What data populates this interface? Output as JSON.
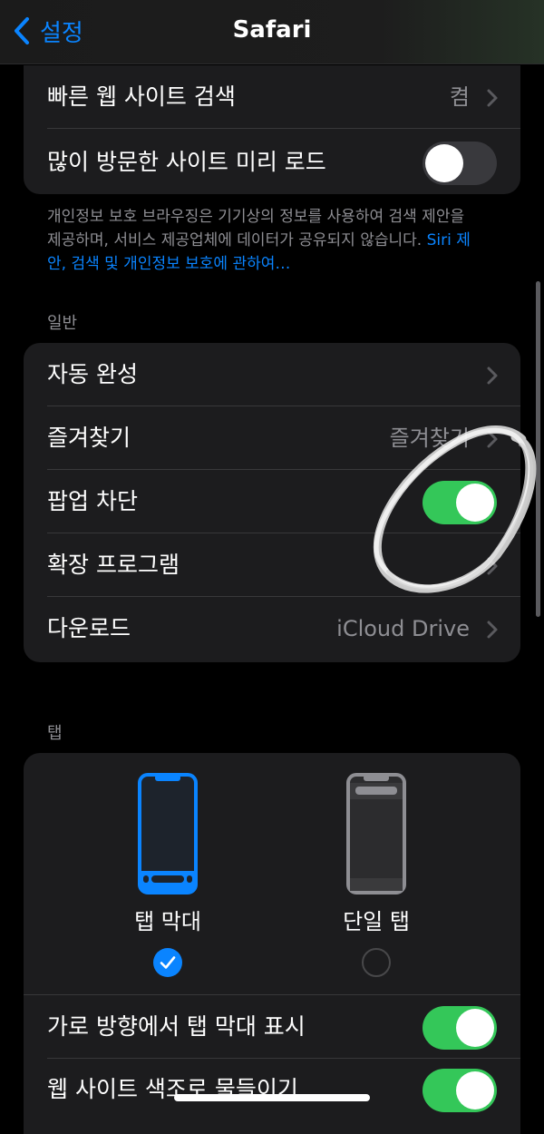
{
  "nav": {
    "back_label": "설정",
    "title": "Safari"
  },
  "group1": {
    "quick_search_label": "빠른 웹 사이트 검색",
    "quick_search_value": "켬",
    "preload_label": "많이 방문한 사이트 미리 로드",
    "preload_on": false
  },
  "footnote": {
    "text": "개인정보 보호 브라우징은 기기상의 정보를 사용하여 검색 제안을 제공하며, 서비스 제공업체에 데이터가 공유되지 않습니다.",
    "link": "Siri 제안, 검색 및 개인정보 보호에 관하여…"
  },
  "general": {
    "header": "일반",
    "autofill_label": "자동 완성",
    "favorites_label": "즐겨찾기",
    "favorites_value": "즐겨찾기",
    "popup_label": "팝업 차단",
    "popup_on": true,
    "extensions_label": "확장 프로그램",
    "downloads_label": "다운로드",
    "downloads_value": "iCloud Drive"
  },
  "tabs": {
    "header": "탭",
    "tab_bar_label": "탭 막대",
    "tab_bar_selected": true,
    "single_tab_label": "단일 탭",
    "single_tab_selected": false,
    "landscape_label": "가로 방향에서 탭 막대 표시",
    "landscape_on": true,
    "tint_label": "웹 사이트 색조로 물들이기",
    "tint_on": true
  },
  "colors": {
    "accent": "#0a84ff",
    "toggle_on": "#34c759"
  }
}
